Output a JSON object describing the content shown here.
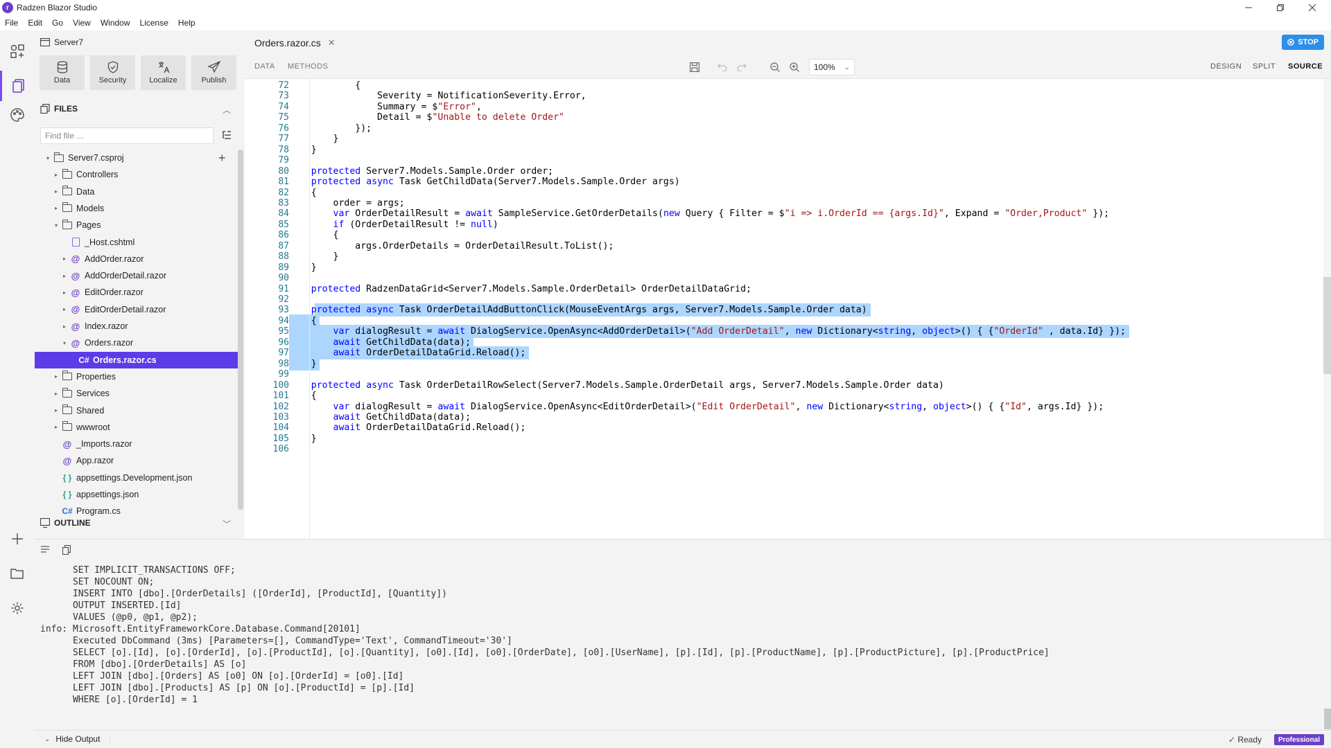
{
  "app": {
    "title": "Radzen Blazor Studio",
    "logo_letter": "r"
  },
  "menu": [
    "File",
    "Edit",
    "Go",
    "View",
    "Window",
    "License",
    "Help"
  ],
  "sidebar": {
    "project": "Server7",
    "tools": [
      {
        "label": "Data",
        "icon": "database-icon"
      },
      {
        "label": "Security",
        "icon": "shield-icon"
      },
      {
        "label": "Localize",
        "icon": "translate-icon"
      },
      {
        "label": "Publish",
        "icon": "send-icon"
      }
    ],
    "files_header": "FILES",
    "find_placeholder": "Find file ...",
    "tree": [
      {
        "label": "Server7.csproj",
        "type": "folder",
        "level": 0,
        "caret": "▾"
      },
      {
        "label": "Controllers",
        "type": "folder",
        "level": 1,
        "caret": "▸"
      },
      {
        "label": "Data",
        "type": "folder",
        "level": 1,
        "caret": "▸"
      },
      {
        "label": "Models",
        "type": "folder",
        "level": 1,
        "caret": "▸"
      },
      {
        "label": "Pages",
        "type": "folder",
        "level": 1,
        "caret": "▾"
      },
      {
        "label": "_Host.cshtml",
        "type": "html",
        "level": 2,
        "caret": ""
      },
      {
        "label": "AddOrder.razor",
        "type": "razor",
        "level": 2,
        "caret": "▸"
      },
      {
        "label": "AddOrderDetail.razor",
        "type": "razor",
        "level": 2,
        "caret": "▸"
      },
      {
        "label": "EditOrder.razor",
        "type": "razor",
        "level": 2,
        "caret": "▸"
      },
      {
        "label": "EditOrderDetail.razor",
        "type": "razor",
        "level": 2,
        "caret": "▸"
      },
      {
        "label": "Index.razor",
        "type": "razor",
        "level": 2,
        "caret": "▸"
      },
      {
        "label": "Orders.razor",
        "type": "razor",
        "level": 2,
        "caret": "▾"
      },
      {
        "label": "Orders.razor.cs",
        "type": "cs",
        "level": 3,
        "caret": "",
        "selected": true
      },
      {
        "label": "Properties",
        "type": "folder",
        "level": 1,
        "caret": "▸"
      },
      {
        "label": "Services",
        "type": "folder",
        "level": 1,
        "caret": "▸"
      },
      {
        "label": "Shared",
        "type": "folder",
        "level": 1,
        "caret": "▸"
      },
      {
        "label": "wwwroot",
        "type": "folder",
        "level": 1,
        "caret": "▸"
      },
      {
        "label": "_Imports.razor",
        "type": "razor",
        "level": 1,
        "caret": ""
      },
      {
        "label": "App.razor",
        "type": "razor",
        "level": 1,
        "caret": ""
      },
      {
        "label": "appsettings.Development.json",
        "type": "json",
        "level": 1,
        "caret": ""
      },
      {
        "label": "appsettings.json",
        "type": "json",
        "level": 1,
        "caret": ""
      },
      {
        "label": "Program.cs",
        "type": "cs",
        "level": 1,
        "caret": ""
      }
    ],
    "outline_header": "OUTLINE"
  },
  "editor": {
    "tab": "Orders.razor.cs",
    "stop_label": "STOP",
    "subtabs": [
      "DATA",
      "METHODS"
    ],
    "zoom": "100%",
    "view_modes": [
      "DESIGN",
      "SPLIT",
      "SOURCE"
    ],
    "active_view": "SOURCE",
    "lines": [
      {
        "n": "72",
        "t": "            {"
      },
      {
        "n": "73",
        "t": "                Severity = NotificationSeverity.Error,"
      },
      {
        "n": "74",
        "t": "                Summary = $\"Error\","
      },
      {
        "n": "75",
        "t": "                Detail = $\"Unable to delete Order\""
      },
      {
        "n": "76",
        "t": "            });"
      },
      {
        "n": "77",
        "t": "        }"
      },
      {
        "n": "78",
        "t": "    }"
      },
      {
        "n": "79",
        "t": ""
      },
      {
        "n": "80",
        "t": "    protected Server7.Models.Sample.Order order;"
      },
      {
        "n": "81",
        "t": "    protected async Task GetChildData(Server7.Models.Sample.Order args)"
      },
      {
        "n": "82",
        "t": "    {"
      },
      {
        "n": "83",
        "t": "        order = args;"
      },
      {
        "n": "84",
        "t": "        var OrderDetailResult = await SampleService.GetOrderDetails(new Query { Filter = $\"i => i.OrderId == {args.Id}\", Expand = \"Order,Product\" });"
      },
      {
        "n": "85",
        "t": "        if (OrderDetailResult != null)"
      },
      {
        "n": "86",
        "t": "        {"
      },
      {
        "n": "87",
        "t": "            args.OrderDetails = OrderDetailResult.ToList();"
      },
      {
        "n": "88",
        "t": "        }"
      },
      {
        "n": "89",
        "t": "    }"
      },
      {
        "n": "90",
        "t": ""
      },
      {
        "n": "91",
        "t": "    protected RadzenDataGrid<Server7.Models.Sample.OrderDetail> OrderDetailDataGrid;"
      },
      {
        "n": "92",
        "t": ""
      },
      {
        "n": "93",
        "t": "    protected async Task OrderDetailAddButtonClick(MouseEventArgs args, Server7.Models.Sample.Order data)"
      },
      {
        "n": "94",
        "t": "    {"
      },
      {
        "n": "95",
        "t": "        var dialogResult = await DialogService.OpenAsync<AddOrderDetail>(\"Add OrderDetail\", new Dictionary<string, object>() { {\"OrderId\" , data.Id} });"
      },
      {
        "n": "96",
        "t": "        await GetChildData(data);"
      },
      {
        "n": "97",
        "t": "        await OrderDetailDataGrid.Reload();"
      },
      {
        "n": "98",
        "t": "    }"
      },
      {
        "n": "99",
        "t": ""
      },
      {
        "n": "100",
        "t": "    protected async Task OrderDetailRowSelect(Server7.Models.Sample.OrderDetail args, Server7.Models.Sample.Order data)"
      },
      {
        "n": "101",
        "t": "    {"
      },
      {
        "n": "102",
        "t": "        var dialogResult = await DialogService.OpenAsync<EditOrderDetail>(\"Edit OrderDetail\", new Dictionary<string, object>() { {\"Id\", args.Id} });"
      },
      {
        "n": "103",
        "t": "        await GetChildData(data);"
      },
      {
        "n": "104",
        "t": "        await OrderDetailDataGrid.Reload();"
      },
      {
        "n": "105",
        "t": "    }"
      },
      {
        "n": "106",
        "t": ""
      }
    ]
  },
  "output": {
    "text": "      SET IMPLICIT_TRANSACTIONS OFF;\n      SET NOCOUNT ON;\n      INSERT INTO [dbo].[OrderDetails] ([OrderId], [ProductId], [Quantity])\n      OUTPUT INSERTED.[Id]\n      VALUES (@p0, @p1, @p2);\ninfo: Microsoft.EntityFrameworkCore.Database.Command[20101]\n      Executed DbCommand (3ms) [Parameters=[], CommandType='Text', CommandTimeout='30']\n      SELECT [o].[Id], [o].[OrderId], [o].[ProductId], [o].[Quantity], [o0].[Id], [o0].[OrderDate], [o0].[UserName], [p].[Id], [p].[ProductName], [p].[ProductPicture], [p].[ProductPrice]\n      FROM [dbo].[OrderDetails] AS [o]\n      LEFT JOIN [dbo].[Orders] AS [o0] ON [o].[OrderId] = [o0].[Id]\n      LEFT JOIN [dbo].[Products] AS [p] ON [o].[ProductId] = [p].[Id]\n      WHERE [o].[OrderId] = 1"
  },
  "status": {
    "hide_output": "Hide Output",
    "ready": "Ready",
    "license": "Professional"
  },
  "colors": {
    "accent": "#6b3fc8",
    "selection": "#add6ff",
    "stop": "#2e8ee8"
  }
}
